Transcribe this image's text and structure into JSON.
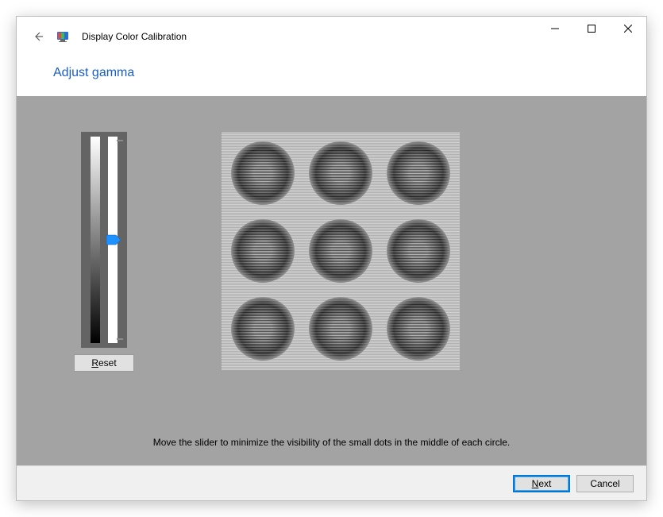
{
  "window": {
    "title": "Display Color Calibration"
  },
  "heading": "Adjust gamma",
  "slider": {
    "reset_label": "Reset",
    "reset_accel_pos": 0,
    "value_percent": 50
  },
  "instruction": "Move the slider to minimize the visibility of the small dots in the middle of each circle.",
  "buttons": {
    "next": "Next",
    "next_accel_pos": 0,
    "cancel": "Cancel"
  },
  "colors": {
    "heading": "#1a5cc8",
    "main_bg": "#a3a3a3",
    "accent": "#0078d7"
  }
}
